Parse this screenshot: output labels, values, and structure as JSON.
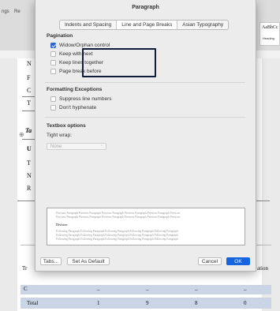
{
  "background": {
    "toolbar_tabs": [
      "ngs",
      "Re"
    ],
    "style_gallery": {
      "sample": "AaBbCc",
      "name": "Heading"
    },
    "doc_letters": [
      "N",
      "F",
      "C",
      "T",
      "Ta",
      "U",
      "T",
      "N",
      "R"
    ],
    "table": {
      "left_labels": [
        "Tr",
        "C"
      ],
      "right_label": "ation",
      "dash": "_",
      "total_label": "Total",
      "total_values": [
        "1",
        "9",
        "8",
        "0"
      ]
    }
  },
  "dialog": {
    "title": "Paragraph",
    "tabs": [
      {
        "label": "Indents and Spacing",
        "active": false
      },
      {
        "label": "Line and Page Breaks",
        "active": true
      },
      {
        "label": "Asian Typography",
        "active": false
      }
    ],
    "pagination": {
      "title": "Pagination",
      "options": [
        {
          "label": "Widow/Orphan control",
          "checked": true
        },
        {
          "label": "Keep with next",
          "checked": false
        },
        {
          "label": "Keep lines together",
          "checked": false
        },
        {
          "label": "Page break before",
          "checked": false
        }
      ]
    },
    "formatting_exceptions": {
      "title": "Formatting Exceptions",
      "options": [
        {
          "label": "Suppress line numbers",
          "checked": false
        },
        {
          "label": "Don't hyphenate",
          "checked": false
        }
      ]
    },
    "textbox_options": {
      "title": "Textbox options",
      "tight_wrap_label": "Tight wrap:",
      "tight_wrap_value": "None"
    },
    "preview": {
      "previous_text": "Previous Paragraph Previous Paragraph Previous Paragraph Previous Paragraph Previous Paragraph Previous",
      "sample": "Division",
      "following_text": "Following Paragraph Following Paragraph Following Paragraph Following Paragraph Following Paragraph"
    },
    "buttons": {
      "tabs": "Tabs...",
      "set_default": "Set As Default",
      "cancel": "Cancel",
      "ok": "OK"
    }
  }
}
